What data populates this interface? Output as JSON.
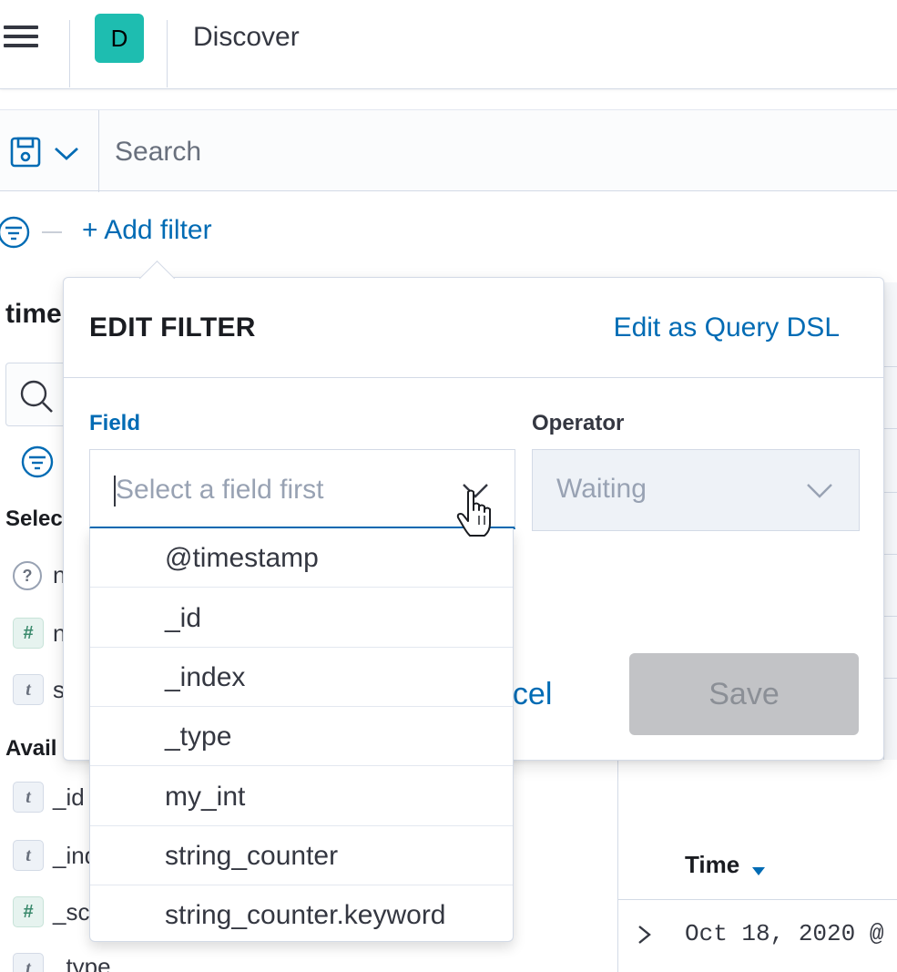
{
  "header": {
    "avatar_letter": "D",
    "app_title": "Discover"
  },
  "search": {
    "placeholder": "Search"
  },
  "filter_bar": {
    "add_filter_label": "+ Add filter"
  },
  "sidebar": {
    "index_pattern_partial": "time",
    "selected_section_partial": "Selec",
    "available_section_partial": "Avail",
    "selected_fields": [
      {
        "type": "unknown",
        "type_glyph": "?",
        "name_partial": "n"
      },
      {
        "type": "number",
        "type_glyph": "#",
        "name_partial": "n"
      },
      {
        "type": "string",
        "type_glyph": "t",
        "name_partial": "s"
      }
    ],
    "available_fields": [
      {
        "type": "string",
        "type_glyph": "t",
        "name_partial": "_id"
      },
      {
        "type": "string",
        "type_glyph": "t",
        "name_partial": "_ind"
      },
      {
        "type": "number",
        "type_glyph": "#",
        "name_partial": "_sc"
      },
      {
        "type": "string",
        "type_glyph": "t",
        "name_partial": "_type"
      }
    ]
  },
  "table": {
    "time_header": "Time",
    "first_row_time": "Oct 18, 2020 @"
  },
  "edit_filter": {
    "title": "EDIT FILTER",
    "edit_as_dsl": "Edit as Query DSL",
    "field_label": "Field",
    "field_placeholder": "Select a field first",
    "operator_label": "Operator",
    "operator_value": "Waiting",
    "cancel_label_partial": "ncel",
    "save_label": "Save",
    "field_options": [
      "@timestamp",
      "_id",
      "_index",
      "_type",
      "my_int",
      "string_counter",
      "string_counter.keyword"
    ]
  },
  "colors": {
    "accent": "#006bb4",
    "avatar_bg": "#1ebdb0",
    "disabled_button": "#c2c3c6"
  },
  "icons": {
    "menu": "hamburger-icon",
    "save": "floppy-disk-icon",
    "chevron": "chevron-down-icon",
    "filter": "filter-icon",
    "search": "magnifier-icon",
    "cursor": "hand-pointer-icon"
  }
}
